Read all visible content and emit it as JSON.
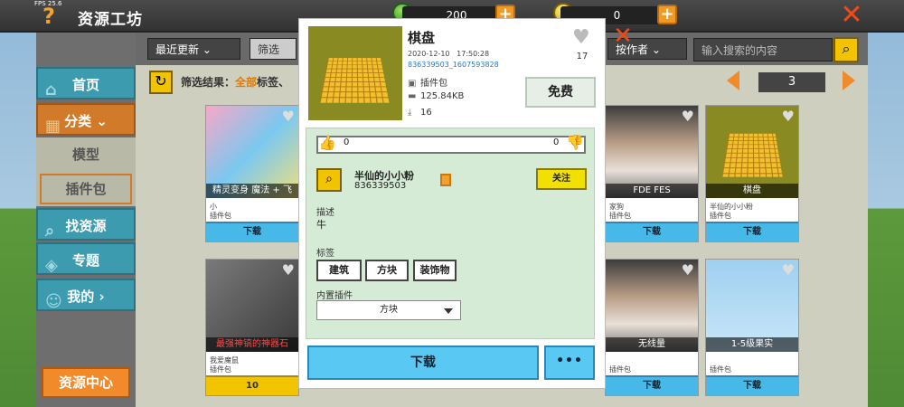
{
  "status": {
    "fps": "FPS 25.6"
  },
  "header": {
    "title": "资源工坊",
    "help_icon": "question-icon",
    "close_icon": "close-icon"
  },
  "currency": {
    "coins": "200",
    "beans": "0"
  },
  "sidebar": {
    "items": [
      {
        "label": "首页",
        "icon": "home-icon"
      },
      {
        "label": "分类",
        "icon": "category-icon"
      },
      {
        "label": "找资源",
        "icon": "search-icon"
      },
      {
        "label": "专题",
        "icon": "topic-icon"
      },
      {
        "label": "我的",
        "icon": "user-icon"
      }
    ],
    "subitems": [
      "模型",
      "插件包"
    ],
    "footer": "资源中心"
  },
  "filters": {
    "sort": "最近更新",
    "filter_btn": "筛选",
    "author_dd": "按作者",
    "search_placeholder": "输入搜索的内容",
    "result_label": "筛选结果：",
    "result_highlight": "全部",
    "result_rest": "标签、",
    "page": "3"
  },
  "cards": [
    {
      "caption": "精灵变身 魔法 + 飞",
      "author": "小",
      "type": "插件包",
      "action": "下载"
    },
    {
      "caption": "FDE FES",
      "author": "家狗",
      "type": "插件包",
      "action": "下载"
    },
    {
      "caption": "棋盘",
      "author": "半仙的小小粉",
      "type": "插件包",
      "action": "下载"
    },
    {
      "caption": "最强神镐的神器石",
      "author": "我爱魔鼠",
      "type": "插件包",
      "action": "10"
    },
    {
      "caption": "无线量",
      "author": "",
      "type": "插件包",
      "action": "下载"
    },
    {
      "caption": "1-5级果实",
      "author": "",
      "type": "插件包",
      "action": "下载"
    }
  ],
  "modal": {
    "title": "棋盘",
    "date": "2020-12-10",
    "time": "17:50:28",
    "id": "836339503_1607593828",
    "type": "插件包",
    "size": "125.84KB",
    "downloads": "16",
    "likes": "17",
    "price_btn": "免费",
    "thumbs_up": "0",
    "thumbs_down": "0",
    "author_name": "半仙的小小粉",
    "author_id": "836339503",
    "follow_btn": "关注",
    "desc_label": "描述",
    "desc": "牛",
    "tags_label": "标签",
    "tags": [
      "建筑",
      "方块",
      "装饰物"
    ],
    "plugins_label": "内置插件",
    "plugin_selected": "方块",
    "download_btn": "下载",
    "more_btn": "•••"
  }
}
